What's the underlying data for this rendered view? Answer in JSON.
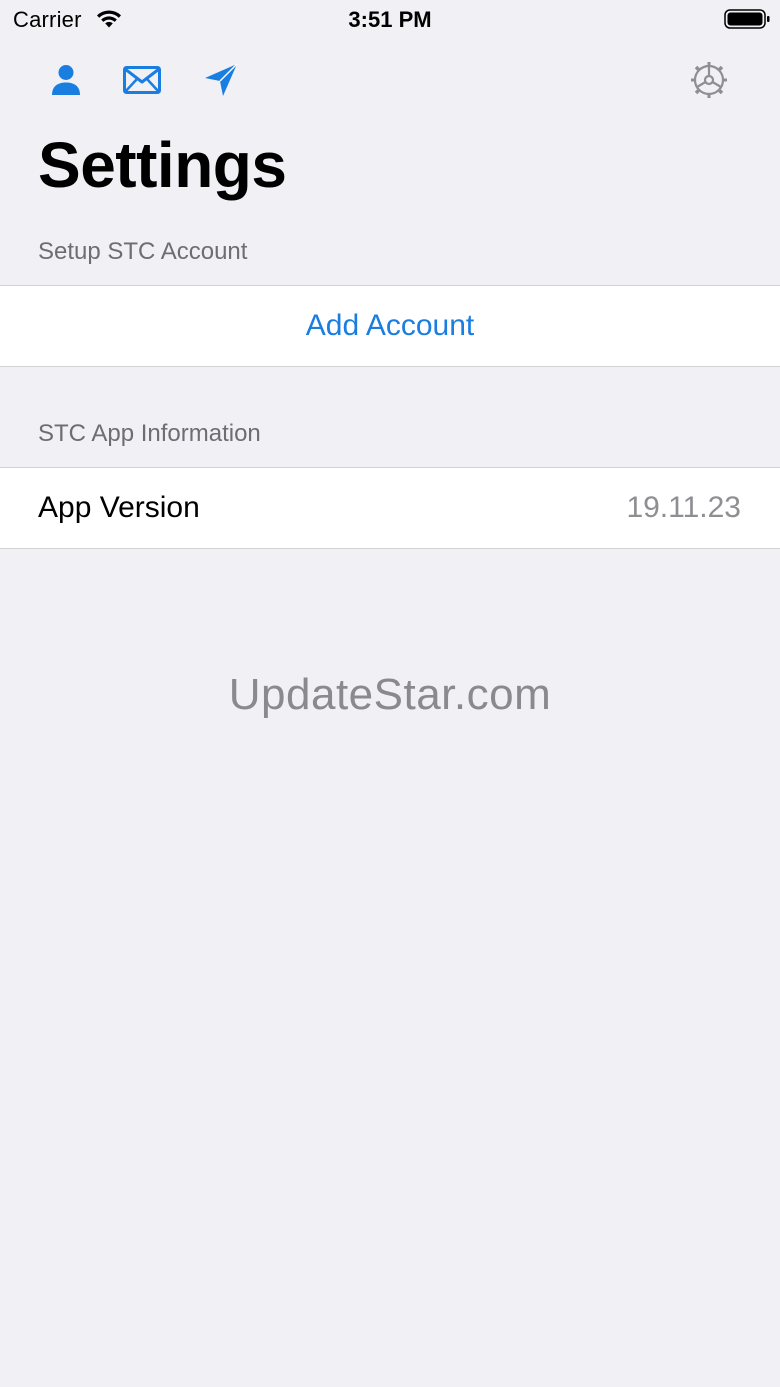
{
  "status_bar": {
    "carrier": "Carrier",
    "time": "3:51 PM"
  },
  "toolbar": {
    "icons": {
      "account": "person-icon",
      "mail": "envelope-icon",
      "send": "paper-plane-icon",
      "settings": "gear-icon"
    },
    "accent_color": "#1a7de0",
    "settings_icon_color": "#8e8e93"
  },
  "page": {
    "title": "Settings"
  },
  "sections": {
    "account": {
      "header": "Setup STC Account",
      "add_account_label": "Add Account"
    },
    "info": {
      "header": "STC App Information",
      "app_version_label": "App Version",
      "app_version_value": "19.11.23"
    }
  },
  "watermark": "UpdateStar.com"
}
